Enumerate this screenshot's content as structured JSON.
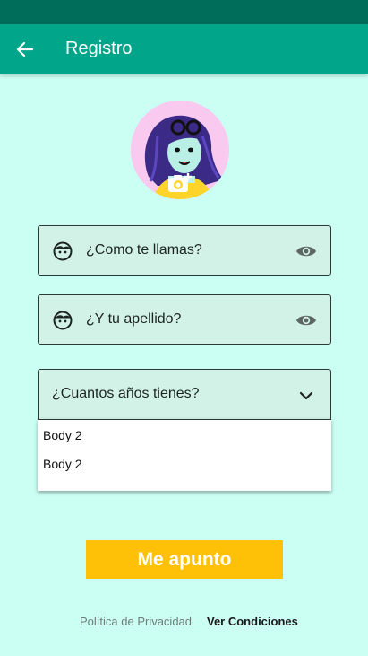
{
  "appbar": {
    "title": "Registro"
  },
  "form": {
    "name_field": {
      "label": "¿Como te llamas?"
    },
    "surname_field": {
      "label": "¿Y tu apellido?"
    },
    "age_select": {
      "label": "¿Cuantos años tienes?"
    },
    "age_menu": {
      "items": [
        "Body 2",
        "Body 2"
      ]
    },
    "submit_label": "Me apunto"
  },
  "footer": {
    "privacy_label": "Política de Privacidad",
    "terms_label": "Ver Condiciones"
  },
  "colors": {
    "background": "#ccfff4",
    "appbar": "#00a58a",
    "statusbar": "#006c5a",
    "accent": "#ffc107",
    "field_fill": "#d2f2e7"
  }
}
